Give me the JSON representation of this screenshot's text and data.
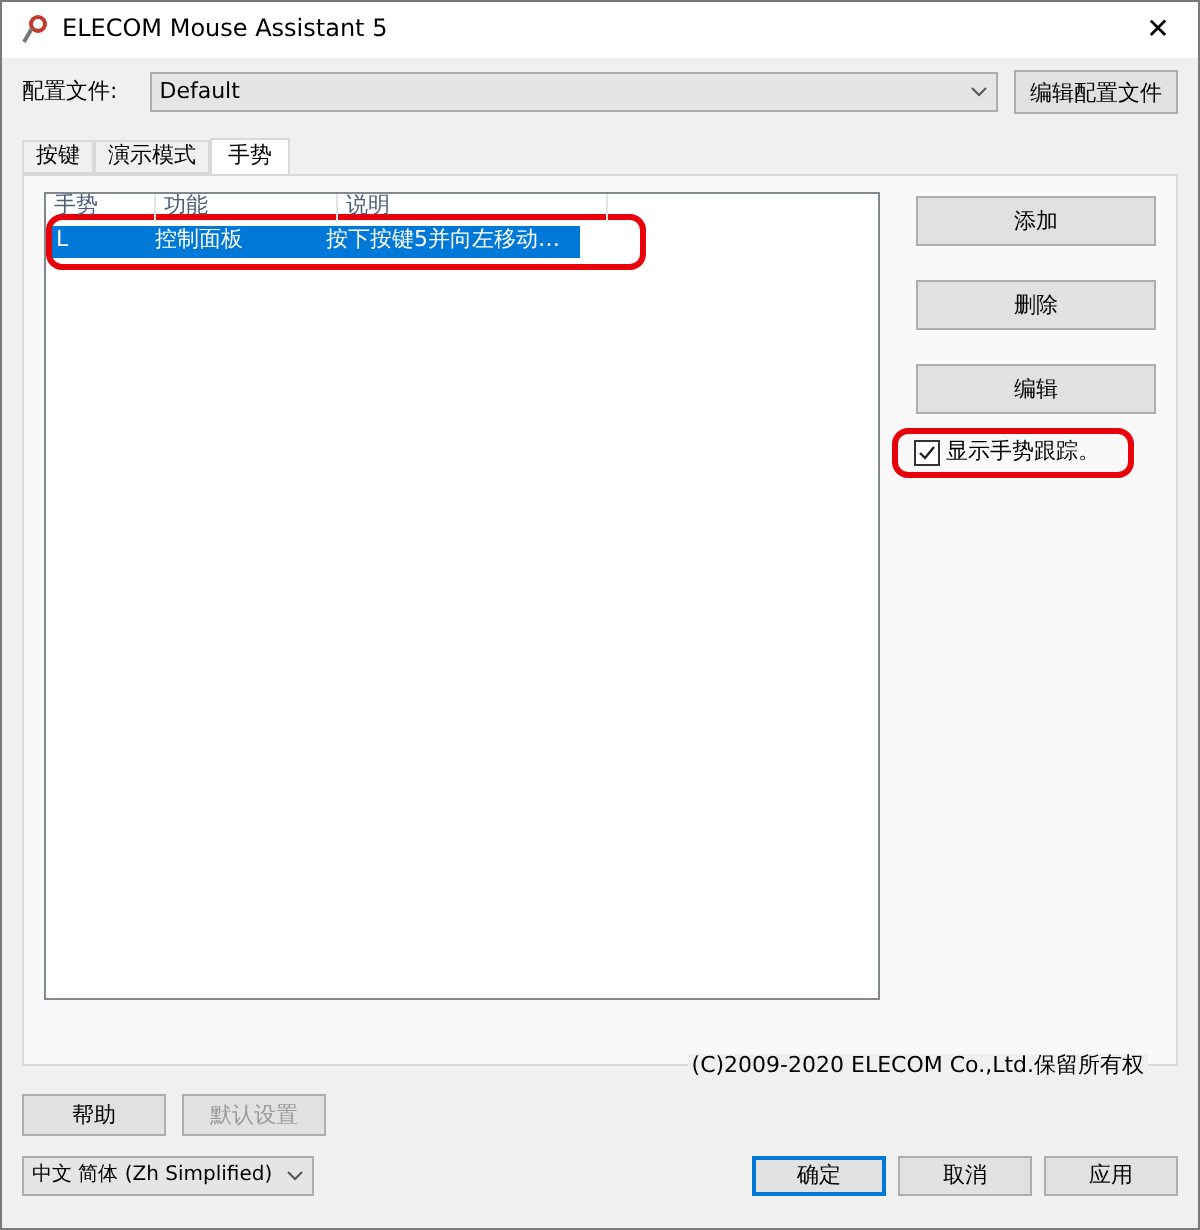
{
  "window": {
    "title": "ELECOM Mouse Assistant 5",
    "close": "✕"
  },
  "profile": {
    "label": "配置文件:",
    "value": "Default",
    "edit_button": "编辑配置文件"
  },
  "tabs": [
    {
      "label": "按键",
      "selected": false
    },
    {
      "label": "演示模式",
      "selected": false
    },
    {
      "label": "手势",
      "selected": true
    }
  ],
  "table": {
    "columns": [
      "手势",
      "功能",
      "说明"
    ],
    "rows": [
      {
        "cells": [
          "L",
          "控制面板",
          "按下按键5并向左移动…"
        ],
        "selected": true,
        "highlighted": true
      }
    ]
  },
  "side_buttons": [
    "添加",
    "删除",
    "编辑"
  ],
  "show_trail": {
    "label": "显示手势跟踪。",
    "checked": true,
    "highlighted": true
  },
  "copyright": "(C)2009-2020 ELECOM Co.,Ltd.保留所有权",
  "help_button": {
    "label": "帮助",
    "disabled": false
  },
  "default_button": {
    "label": "默认设置",
    "disabled": true
  },
  "language": {
    "value": "中文 简体 (Zh Simplified)"
  },
  "dialog_buttons": [
    {
      "label": "确定",
      "default": true
    },
    {
      "label": "取消",
      "default": false
    },
    {
      "label": "应用",
      "default": false
    }
  ]
}
